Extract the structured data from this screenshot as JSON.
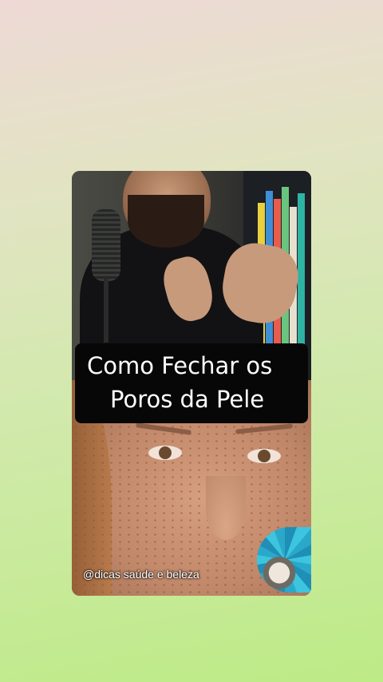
{
  "video": {
    "caption_line1": "Como Fechar os",
    "caption_line2": "Poros da Pele",
    "watermark": "@dicas saúde e beleza"
  },
  "colors": {
    "background_top": "#eed9d6",
    "background_bottom": "#bdeb86",
    "caption_bg": "#070707",
    "caption_text": "#ffffff"
  }
}
